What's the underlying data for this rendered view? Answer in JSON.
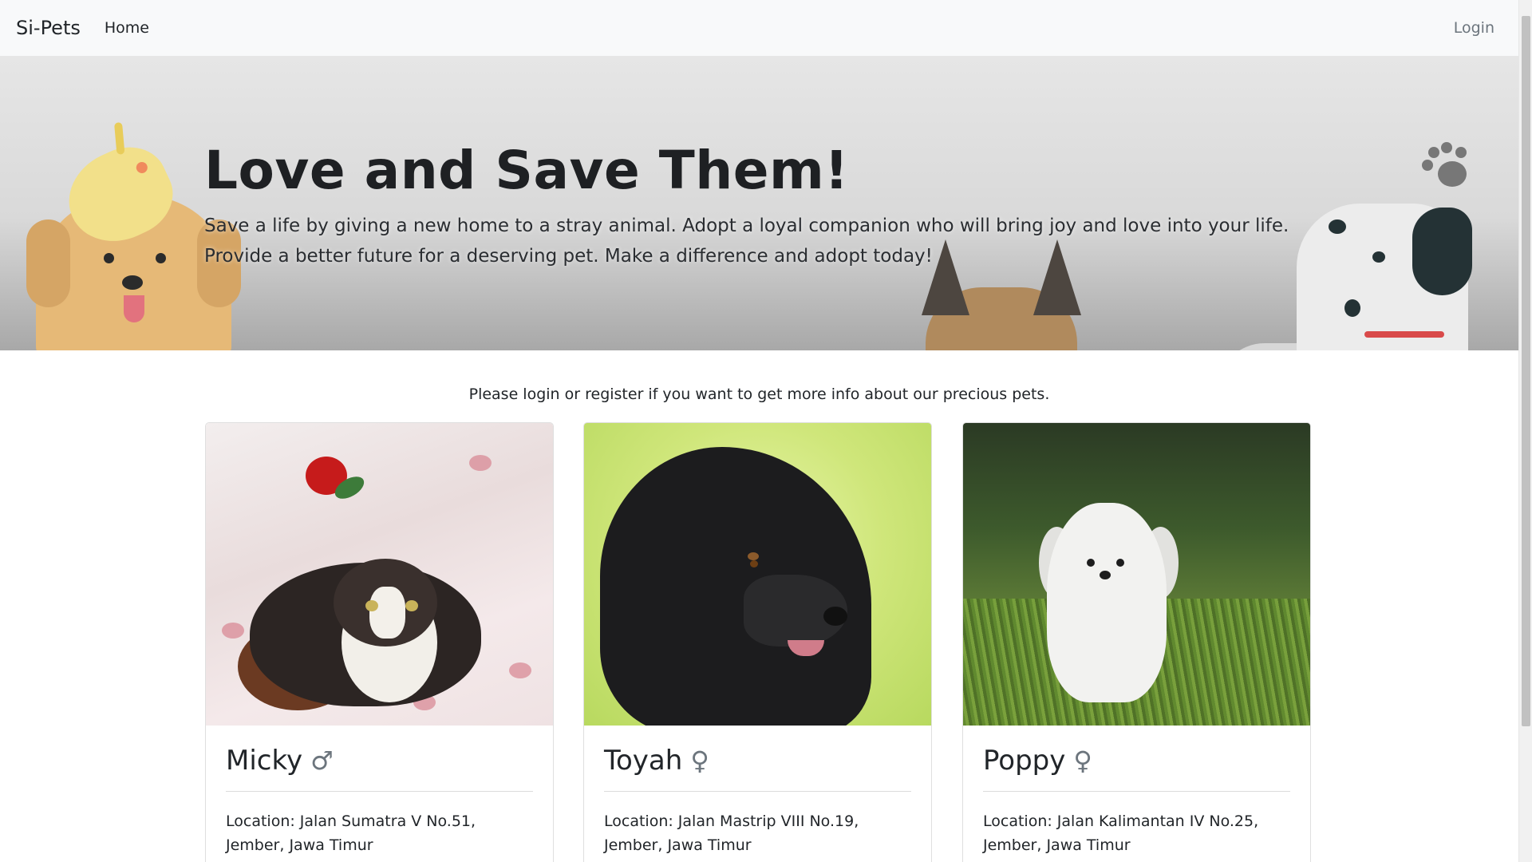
{
  "navbar": {
    "brand": "Si-Pets",
    "home": "Home",
    "login": "Login"
  },
  "hero": {
    "title": "Love and Save Them!",
    "text": "Save a life by giving a new home to a stray animal. Adopt a loyal companion who will bring joy and love into your life. Provide a better future for a deserving pet. Make a difference and adopt today!"
  },
  "intro": "Please login or register if you want to get more info about our precious pets.",
  "pets": [
    {
      "name": "Micky",
      "gender_symbol": "♂",
      "location": "Location: Jalan Sumatra V No.51, Jember, Jawa Timur",
      "photo_icon": "cat-photo"
    },
    {
      "name": "Toyah",
      "gender_symbol": "♀",
      "location": "Location: Jalan Mastrip VIII No.19, Jember, Jawa Timur",
      "photo_icon": "dog-photo"
    },
    {
      "name": "Poppy",
      "gender_symbol": "♀",
      "location": "Location: Jalan Kalimantan IV No.25, Jember, Jawa Timur",
      "photo_icon": "puppy-photo"
    }
  ],
  "colors": {
    "navbar_bg": "#f8f9fa",
    "text": "#212529",
    "muted": "#6c757d"
  }
}
